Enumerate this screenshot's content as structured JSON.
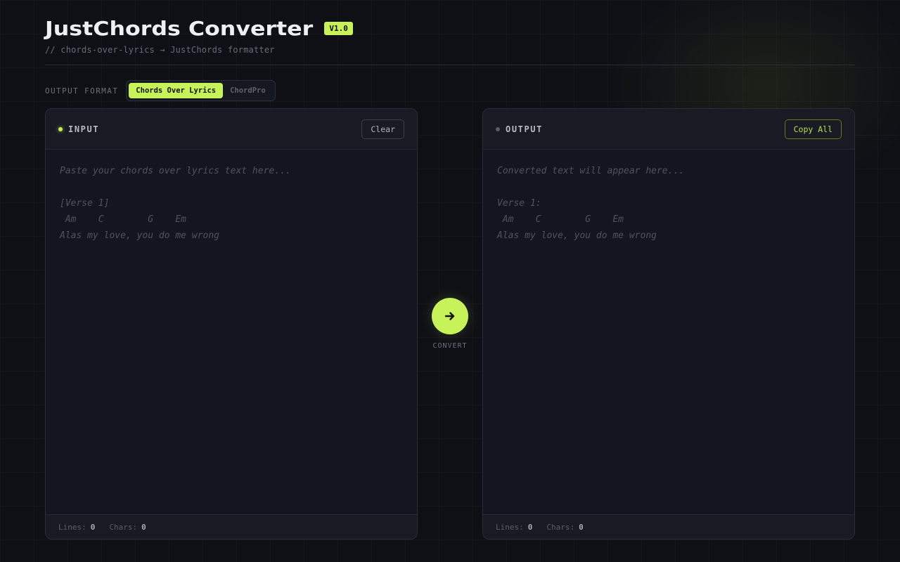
{
  "header": {
    "title": "JustChords Converter",
    "version": "V1.0",
    "subtitle": "// chords-over-lyrics → JustChords formatter"
  },
  "format": {
    "label": "OUTPUT FORMAT",
    "options": [
      "Chords Over Lyrics",
      "ChordPro"
    ],
    "selected": "Chords Over Lyrics"
  },
  "input_panel": {
    "title": "INPUT",
    "clear_label": "Clear",
    "placeholder": "Paste your chords over lyrics text here...\n\n[Verse 1]\n Am    C        G    Em\nAlas my love, you do me wrong",
    "stats": {
      "lines_label": "Lines:",
      "lines": "0",
      "chars_label": "Chars:",
      "chars": "0"
    }
  },
  "output_panel": {
    "title": "OUTPUT",
    "copy_label": "Copy All",
    "placeholder": "Converted text will appear here...\n\nVerse 1:\n Am    C        G    Em\nAlas my love, you do me wrong",
    "stats": {
      "lines_label": "Lines:",
      "lines": "0",
      "chars_label": "Chars:",
      "chars": "0"
    }
  },
  "convert": {
    "label": "CONVERT",
    "icon": "arrow-right-icon"
  },
  "colors": {
    "accent": "#c8f25a",
    "background": "#0e1016",
    "panel": "#131620"
  }
}
